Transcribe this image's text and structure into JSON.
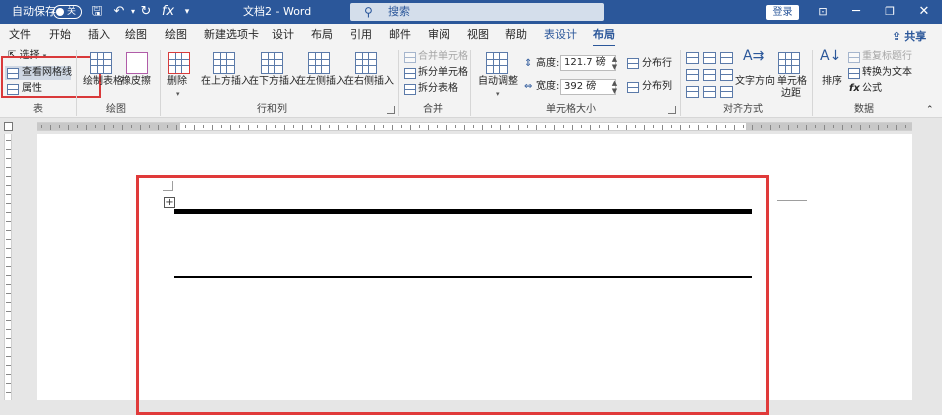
{
  "titlebar": {
    "autosave_label": "自动保存",
    "autosave_state": "关",
    "doc_title": "文档2 - Word",
    "search_placeholder": "搜索",
    "login_label": "登录",
    "bg_color": "#2b579a"
  },
  "tabs": [
    {
      "label": "文件"
    },
    {
      "label": "开始"
    },
    {
      "label": "插入"
    },
    {
      "label": "绘图"
    },
    {
      "label": "绘图"
    },
    {
      "label": "新建选项卡"
    },
    {
      "label": "设计"
    },
    {
      "label": "布局"
    },
    {
      "label": "引用"
    },
    {
      "label": "邮件"
    },
    {
      "label": "审阅"
    },
    {
      "label": "视图"
    },
    {
      "label": "帮助"
    },
    {
      "label": "表设计"
    },
    {
      "label": "布局"
    }
  ],
  "share_label": "共享",
  "ribbon": {
    "table": {
      "select": "选择",
      "view_gridlines": "查看网格线",
      "properties": "属性",
      "group": "表"
    },
    "draw": {
      "draw_table": "绘制表格",
      "eraser": "橡皮擦",
      "group": "绘图"
    },
    "rows_cols": {
      "delete": "删除",
      "insert_above": "在上方插入",
      "insert_below": "在下方插入",
      "insert_left": "在左侧插入",
      "insert_right": "在右侧插入",
      "group": "行和列"
    },
    "merge": {
      "merge_cells": "合并单元格",
      "split_cells": "拆分单元格",
      "split_table": "拆分表格",
      "group": "合并"
    },
    "cell_size": {
      "autofit": "自动调整",
      "height_label": "高度:",
      "height_value": "121.7 磅",
      "width_label": "宽度:",
      "width_value": "392 磅",
      "dist_rows": "分布行",
      "dist_cols": "分布列",
      "group": "单元格大小"
    },
    "alignment": {
      "text_direction": "文字方向",
      "cell_margins_1": "单元格",
      "cell_margins_2": "边距",
      "group": "对齐方式"
    },
    "data": {
      "sort": "排序",
      "repeat_header": "重复标题行",
      "convert_text": "转换为文本",
      "formula": "公式",
      "group": "数据"
    }
  },
  "colors": {
    "accent": "#2b579a",
    "highlight_red": "#e03a3a"
  }
}
